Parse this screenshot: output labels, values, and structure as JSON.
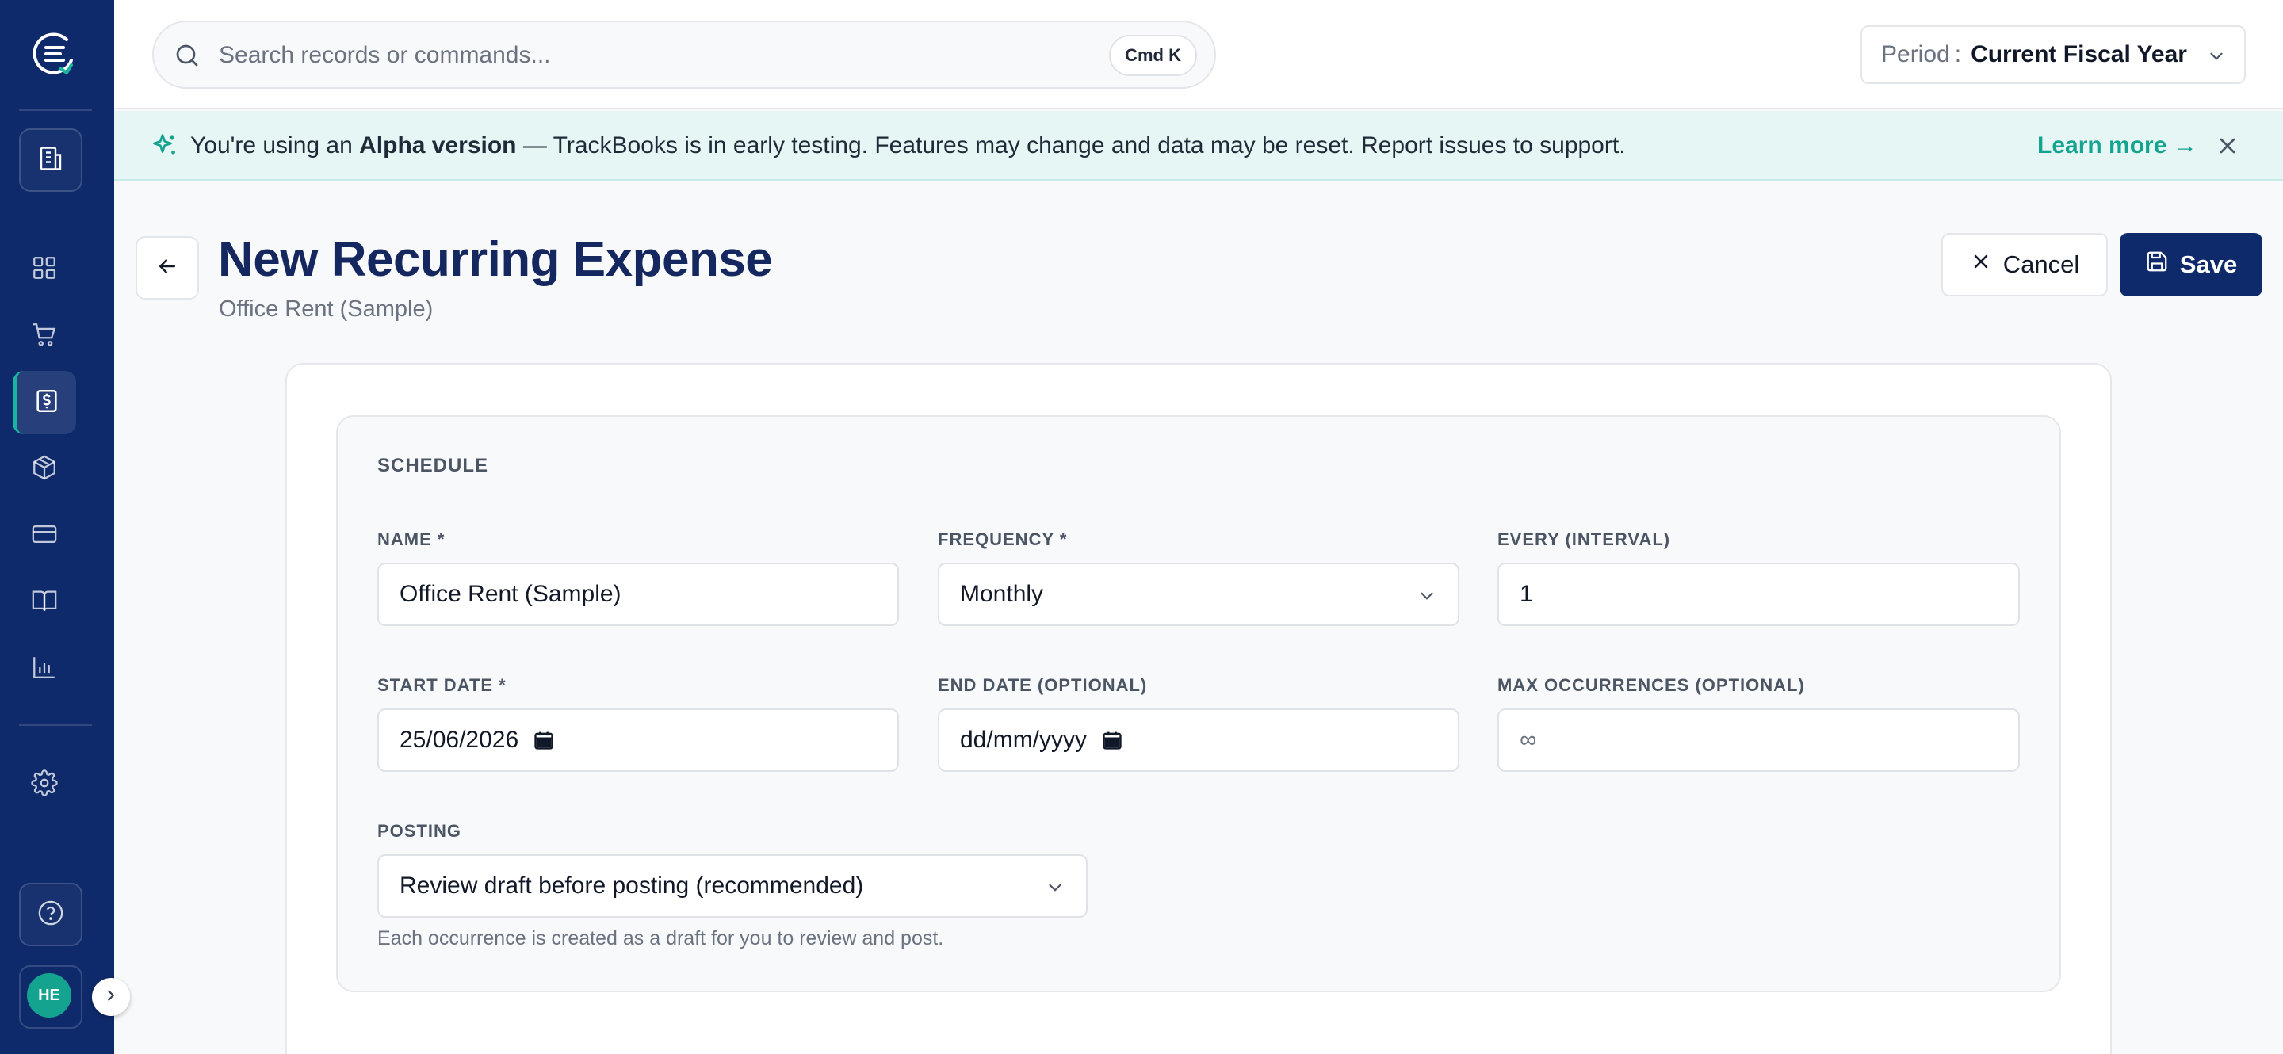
{
  "app": {
    "name": "TrackBooks",
    "user_initials": "HE"
  },
  "search": {
    "placeholder": "Search records or commands...",
    "shortcut": "Cmd K"
  },
  "period": {
    "label": "Period",
    "separator": ":",
    "value": "Current Fiscal Year"
  },
  "banner": {
    "prefix": "You're using an ",
    "highlight": "Alpha version",
    "rest": " — TrackBooks is in early testing. Features may change and data may be reset. Report issues to support.",
    "link": "Learn more →"
  },
  "header": {
    "title": "New Recurring Expense",
    "subtitle": "Office Rent (Sample)",
    "cancel_label": "Cancel",
    "save_label": "Save"
  },
  "schedule": {
    "section_title": "SCHEDULE",
    "name": {
      "label": "NAME *",
      "value": "Office Rent (Sample)"
    },
    "frequency": {
      "label": "FREQUENCY *",
      "value": "Monthly"
    },
    "interval": {
      "label": "EVERY (INTERVAL)",
      "value": "1"
    },
    "start_date": {
      "label": "START DATE *",
      "value": "25/06/2026"
    },
    "end_date": {
      "label": "END DATE (OPTIONAL)",
      "placeholder": "dd/mm/yyyy"
    },
    "max_occurrences": {
      "label": "MAX OCCURRENCES (OPTIONAL)",
      "placeholder": "∞"
    },
    "posting": {
      "label": "POSTING",
      "value": "Review draft before posting (recommended)",
      "helper": "Each occurrence is created as a draft for you to review and post."
    }
  },
  "sidebar": {
    "items": [
      {
        "name": "company",
        "icon": "building-icon"
      },
      {
        "name": "dashboard",
        "icon": "grid-icon"
      },
      {
        "name": "sales",
        "icon": "cart-icon"
      },
      {
        "name": "expenses",
        "icon": "dollar-receipt-icon",
        "active": true
      },
      {
        "name": "inventory",
        "icon": "box-icon"
      },
      {
        "name": "banking",
        "icon": "credit-card-icon"
      },
      {
        "name": "accounting",
        "icon": "book-icon"
      },
      {
        "name": "reports",
        "icon": "bar-chart-icon"
      },
      {
        "name": "settings",
        "icon": "gear-icon"
      },
      {
        "name": "help",
        "icon": "help-circle-icon"
      }
    ]
  },
  "colors": {
    "sidebar": "#0f2a6b",
    "accent": "#14a38f",
    "title": "#14275f",
    "banner_bg": "#e6f6f4"
  }
}
